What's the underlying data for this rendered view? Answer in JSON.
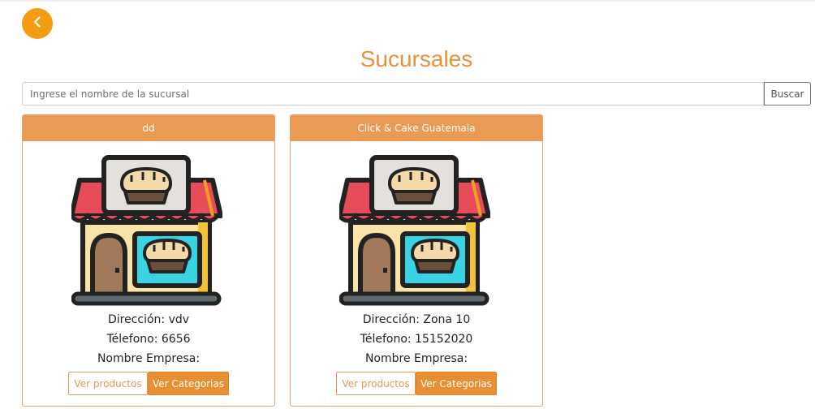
{
  "page": {
    "title": "Sucursales"
  },
  "search": {
    "placeholder": "Ingrese el nombre de la sucursal",
    "button_label": "Buscar"
  },
  "branches": [
    {
      "name": "dd",
      "address_line": "Dirección: vdv",
      "phone_line": "Télefono: 6656",
      "company_line": "Nombre Empresa:"
    },
    {
      "name": "Click & Cake Guatemala",
      "address_line": "Dirección: Zona 10",
      "phone_line": "Télefono: 15152020",
      "company_line": "Nombre Empresa:"
    }
  ],
  "actions": {
    "products_label": "Ver productos",
    "categories_label": "Ver Categorias"
  },
  "colors": {
    "accent": "#f39c12",
    "header": "#ea9a55",
    "title": "#e8913a"
  },
  "icons": {
    "back": "chevron-left-icon",
    "store": "bakery-store-icon"
  }
}
